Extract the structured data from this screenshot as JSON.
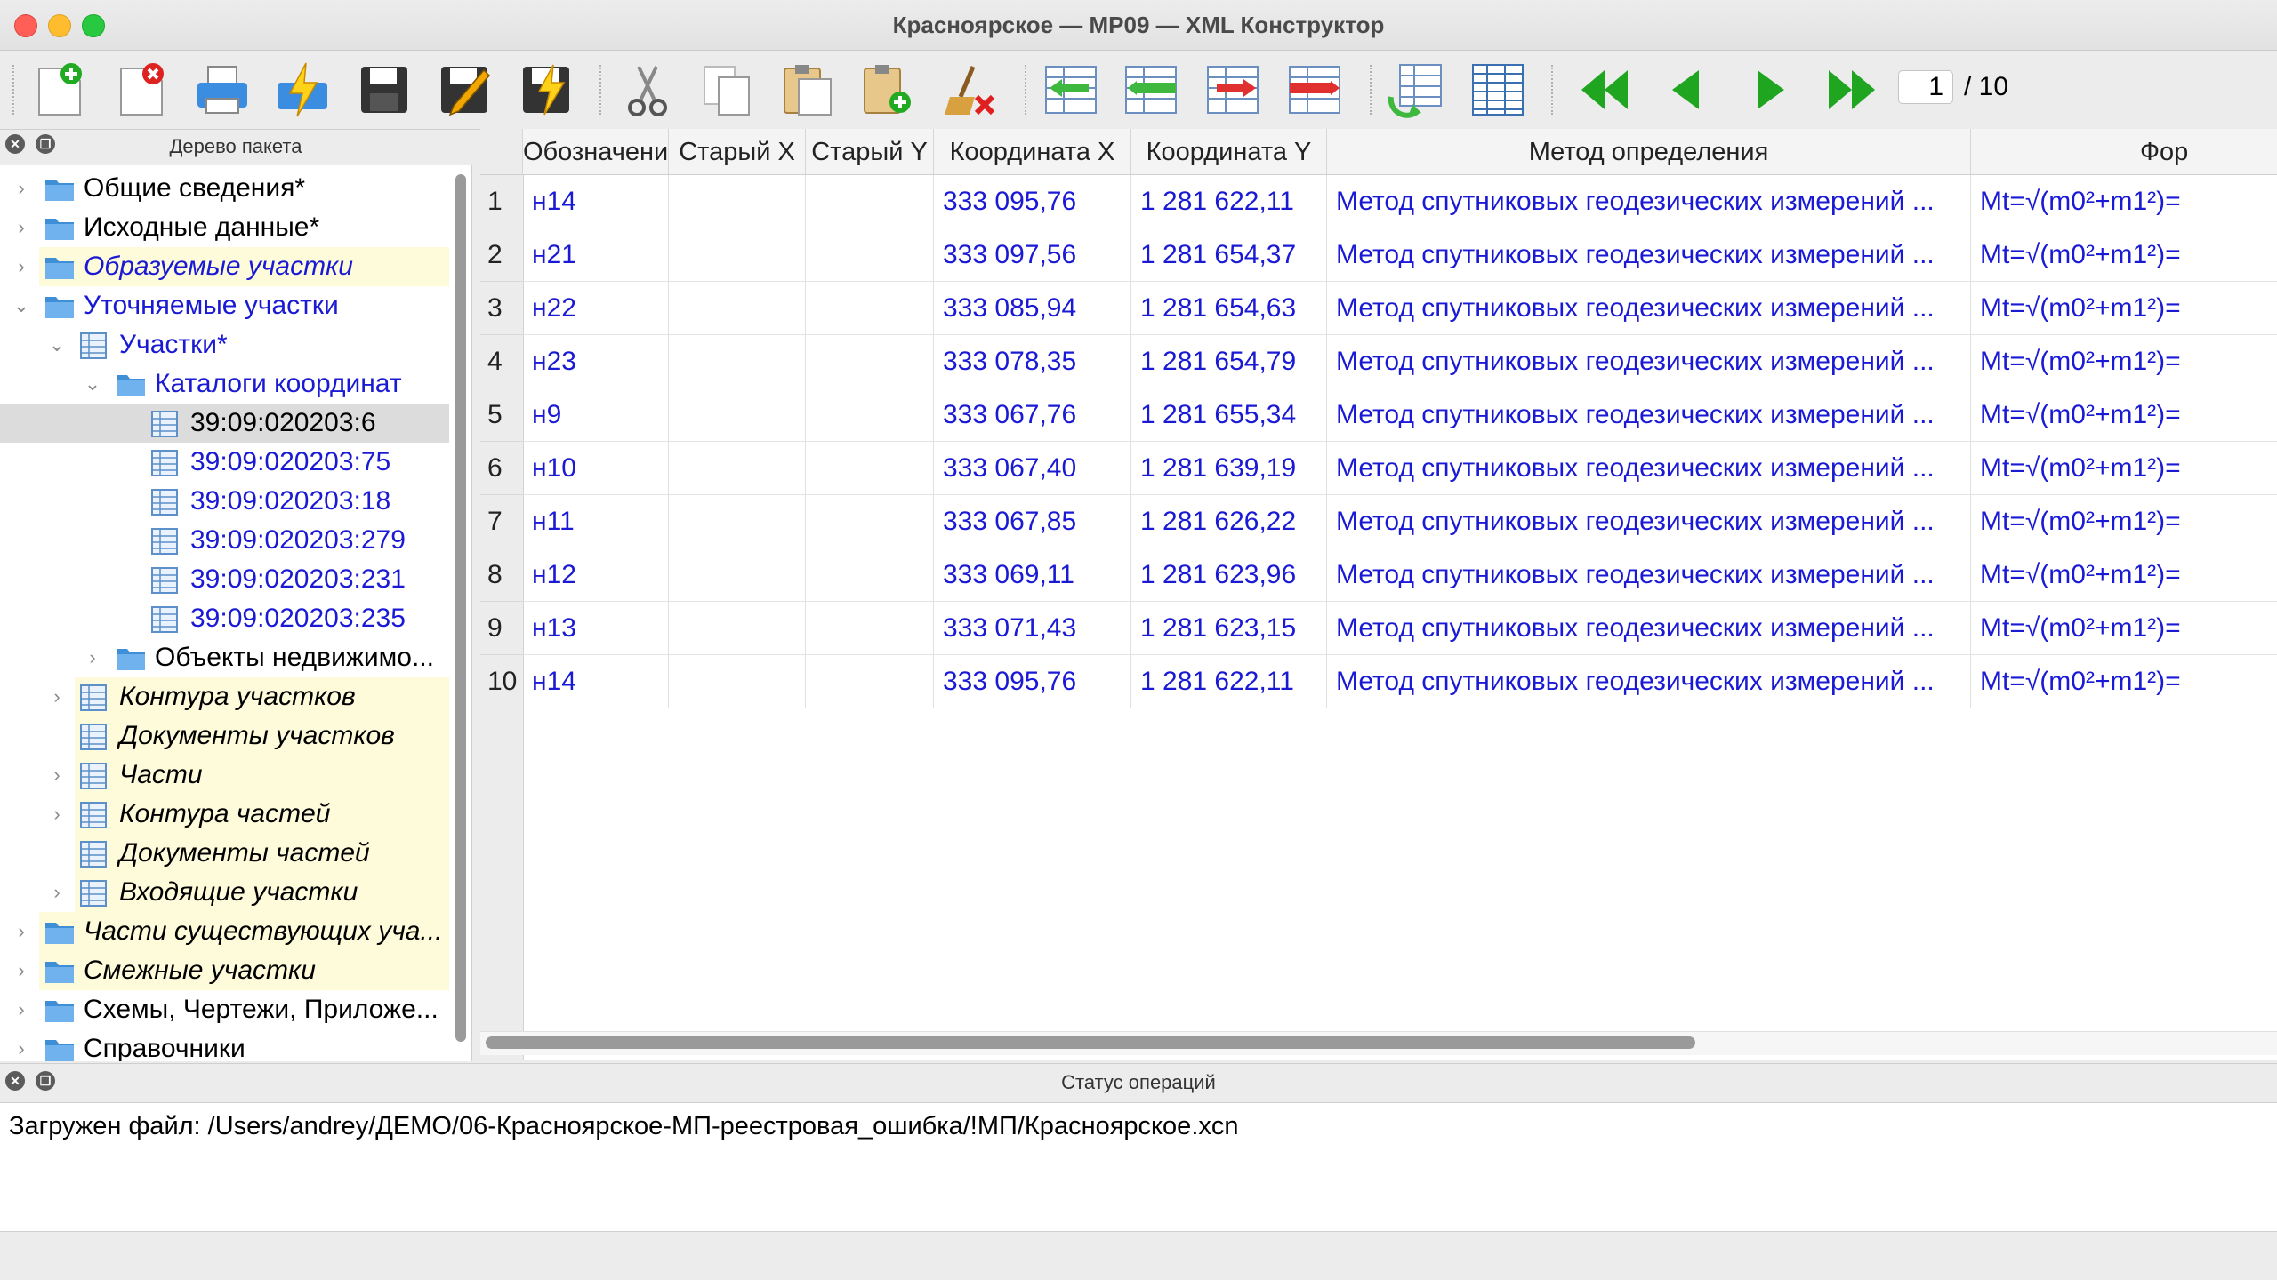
{
  "window": {
    "title": "Красноярское — МР09 — XML Конструктор"
  },
  "toolbar": {
    "buttons": [
      {
        "name": "new-document-button",
        "icon": "new-document-icon"
      },
      {
        "name": "delete-document-button",
        "icon": "delete-document-icon"
      },
      {
        "name": "print-button",
        "icon": "printer-icon"
      },
      {
        "name": "quick-print-button",
        "icon": "lightning-printer-icon"
      },
      {
        "name": "save-button",
        "icon": "floppy-disk-icon"
      },
      {
        "name": "save-as-button",
        "icon": "floppy-pencil-icon"
      },
      {
        "name": "quick-save-button",
        "icon": "floppy-lightning-icon"
      },
      {
        "name": "cut-button",
        "icon": "scissors-icon"
      },
      {
        "name": "copy-button",
        "icon": "copy-icon"
      },
      {
        "name": "paste-button",
        "icon": "paste-icon"
      },
      {
        "name": "paste-add-button",
        "icon": "paste-add-icon"
      },
      {
        "name": "clear-button",
        "icon": "broom-icon"
      },
      {
        "name": "insert-row-before-button",
        "icon": "table-arrow-left-icon"
      },
      {
        "name": "insert-row-button",
        "icon": "table-insert-icon"
      },
      {
        "name": "move-row-button",
        "icon": "table-arrow-right-icon"
      },
      {
        "name": "delete-row-button",
        "icon": "table-delete-icon"
      },
      {
        "name": "refresh-table-button",
        "icon": "table-refresh-icon"
      },
      {
        "name": "table-view-button",
        "icon": "table-view-icon"
      },
      {
        "name": "first-page-button",
        "icon": "double-left-arrow-icon"
      },
      {
        "name": "prev-page-button",
        "icon": "left-arrow-icon"
      },
      {
        "name": "next-page-button",
        "icon": "right-arrow-icon"
      },
      {
        "name": "last-page-button",
        "icon": "double-right-arrow-icon"
      }
    ],
    "page_current": "1",
    "page_total": "/ 10"
  },
  "tree_panel": {
    "title": "Дерево пакета",
    "items": [
      {
        "label": "Общие сведения*",
        "italic": false,
        "blue": false,
        "yellow": false,
        "icon": "folder-icon"
      },
      {
        "label": "Исходные данные*",
        "italic": false,
        "blue": false,
        "yellow": false,
        "icon": "folder-icon"
      },
      {
        "label": "Образуемые участки",
        "italic": true,
        "blue": true,
        "yellow": true,
        "icon": "folder-icon"
      },
      {
        "label": "Уточняемые участки",
        "italic": false,
        "blue": true,
        "yellow": false,
        "icon": "folder-icon"
      },
      {
        "label": "Участки*",
        "italic": false,
        "blue": true,
        "yellow": false,
        "icon": "table-icon"
      },
      {
        "label": "Каталоги координат",
        "italic": false,
        "blue": true,
        "yellow": false,
        "icon": "folder-icon"
      },
      {
        "label": "39:09:020203:6",
        "italic": false,
        "blue": false,
        "yellow": false,
        "icon": "catalog-icon",
        "selected": true
      },
      {
        "label": "39:09:020203:75",
        "italic": false,
        "blue": true,
        "yellow": false,
        "icon": "catalog-icon"
      },
      {
        "label": "39:09:020203:18",
        "italic": false,
        "blue": true,
        "yellow": false,
        "icon": "catalog-icon"
      },
      {
        "label": "39:09:020203:279",
        "italic": false,
        "blue": true,
        "yellow": false,
        "icon": "catalog-icon"
      },
      {
        "label": "39:09:020203:231",
        "italic": false,
        "blue": true,
        "yellow": false,
        "icon": "catalog-icon"
      },
      {
        "label": "39:09:020203:235",
        "italic": false,
        "blue": true,
        "yellow": false,
        "icon": "catalog-icon"
      },
      {
        "label": "Объекты недвижимо...",
        "italic": false,
        "blue": false,
        "yellow": false,
        "icon": "folder-icon"
      },
      {
        "label": "Контура участков",
        "italic": true,
        "blue": false,
        "yellow": true,
        "icon": "table-icon"
      },
      {
        "label": "Документы участков",
        "italic": true,
        "blue": false,
        "yellow": true,
        "icon": "table-icon"
      },
      {
        "label": "Части",
        "italic": true,
        "blue": false,
        "yellow": true,
        "icon": "table-icon"
      },
      {
        "label": "Контура частей",
        "italic": true,
        "blue": false,
        "yellow": true,
        "icon": "table-icon"
      },
      {
        "label": "Документы частей",
        "italic": true,
        "blue": false,
        "yellow": true,
        "icon": "table-icon"
      },
      {
        "label": "Входящие участки",
        "italic": true,
        "blue": false,
        "yellow": true,
        "icon": "table-icon"
      },
      {
        "label": "Части существующих уча...",
        "italic": true,
        "blue": false,
        "yellow": true,
        "icon": "folder-icon"
      },
      {
        "label": "Смежные участки",
        "italic": true,
        "blue": false,
        "yellow": true,
        "icon": "folder-icon"
      },
      {
        "label": "Схемы, Чертежи, Приложе...",
        "italic": false,
        "blue": false,
        "yellow": false,
        "icon": "folder-icon"
      },
      {
        "label": "Справочники",
        "italic": false,
        "blue": false,
        "yellow": false,
        "icon": "folder-icon"
      }
    ]
  },
  "table": {
    "columns": [
      "Обозначение",
      "Старый X",
      "Старый Y",
      "Координата X",
      "Координата Y",
      "Метод определения",
      "Фор"
    ],
    "rows": [
      {
        "n": "1",
        "id": "н14",
        "old_x": "",
        "old_y": "",
        "x": "333 095,76",
        "y": "1 281 622,11",
        "method": "Метод спутниковых геодезических измерений ...",
        "formula": "Mt=√(m0²+m1²)="
      },
      {
        "n": "2",
        "id": "н21",
        "old_x": "",
        "old_y": "",
        "x": "333 097,56",
        "y": "1 281 654,37",
        "method": "Метод спутниковых геодезических измерений ...",
        "formula": "Mt=√(m0²+m1²)="
      },
      {
        "n": "3",
        "id": "н22",
        "old_x": "",
        "old_y": "",
        "x": "333 085,94",
        "y": "1 281 654,63",
        "method": "Метод спутниковых геодезических измерений ...",
        "formula": "Mt=√(m0²+m1²)="
      },
      {
        "n": "4",
        "id": "н23",
        "old_x": "",
        "old_y": "",
        "x": "333 078,35",
        "y": "1 281 654,79",
        "method": "Метод спутниковых геодезических измерений ...",
        "formula": "Mt=√(m0²+m1²)="
      },
      {
        "n": "5",
        "id": "н9",
        "old_x": "",
        "old_y": "",
        "x": "333 067,76",
        "y": "1 281 655,34",
        "method": "Метод спутниковых геодезических измерений ...",
        "formula": "Mt=√(m0²+m1²)="
      },
      {
        "n": "6",
        "id": "н10",
        "old_x": "",
        "old_y": "",
        "x": "333 067,40",
        "y": "1 281 639,19",
        "method": "Метод спутниковых геодезических измерений ...",
        "formula": "Mt=√(m0²+m1²)="
      },
      {
        "n": "7",
        "id": "н11",
        "old_x": "",
        "old_y": "",
        "x": "333 067,85",
        "y": "1 281 626,22",
        "method": "Метод спутниковых геодезических измерений ...",
        "formula": "Mt=√(m0²+m1²)="
      },
      {
        "n": "8",
        "id": "н12",
        "old_x": "",
        "old_y": "",
        "x": "333 069,11",
        "y": "1 281 623,96",
        "method": "Метод спутниковых геодезических измерений ...",
        "formula": "Mt=√(m0²+m1²)="
      },
      {
        "n": "9",
        "id": "н13",
        "old_x": "",
        "old_y": "",
        "x": "333 071,43",
        "y": "1 281 623,15",
        "method": "Метод спутниковых геодезических измерений ...",
        "formula": "Mt=√(m0²+m1²)="
      },
      {
        "n": "10",
        "id": "н14",
        "old_x": "",
        "old_y": "",
        "x": "333 095,76",
        "y": "1 281 622,11",
        "method": "Метод спутниковых геодезических измерений ...",
        "formula": "Mt=√(m0²+m1²)="
      }
    ]
  },
  "status_panel": {
    "title": "Статус операций",
    "message": "Загружен файл: /Users/andrey/ДЕМО/06-Красноярское-МП-реестровая_ошибка/!МП/Красноярское.xcn"
  },
  "colors": {
    "link_blue": "#1a1ad4",
    "tree_yellow": "#fdfbd9",
    "selection_gray": "#dcdcdc",
    "green_arrow": "#1fa51f"
  }
}
